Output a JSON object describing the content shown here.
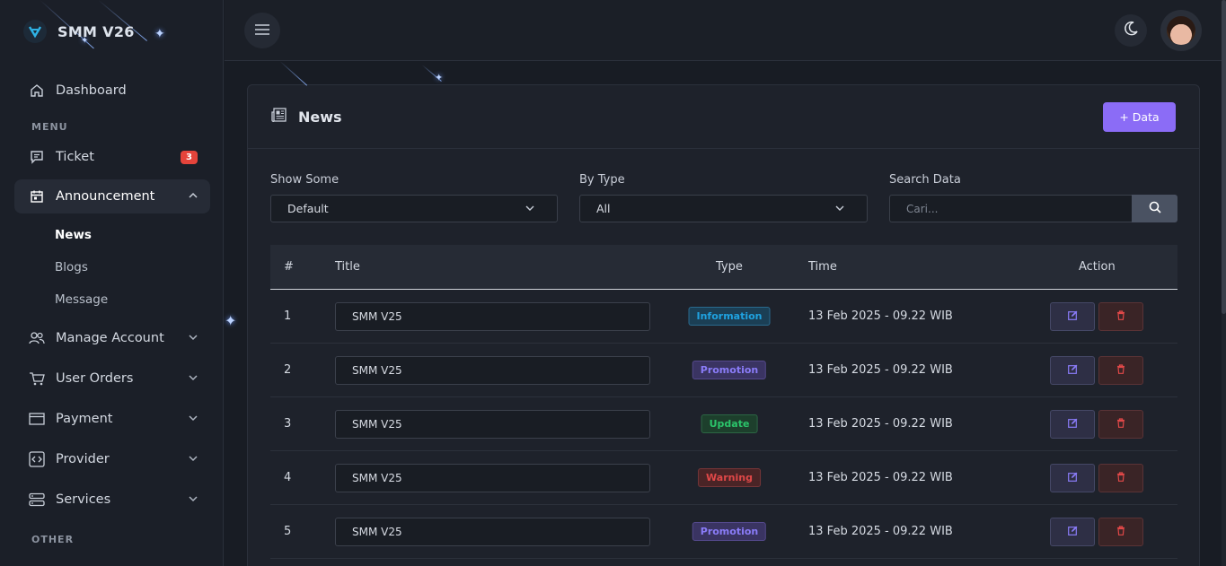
{
  "brand": {
    "name": "SMM V26"
  },
  "sidebar": {
    "dashboard": "Dashboard",
    "menu_label": "MENU",
    "ticket": {
      "label": "Ticket",
      "badge": "3"
    },
    "announcement": {
      "label": "Announcement",
      "children": [
        "News",
        "Blogs",
        "Message"
      ]
    },
    "items": [
      "Manage Account",
      "User Orders",
      "Payment",
      "Provider",
      "Services"
    ],
    "other_label": "OTHER"
  },
  "page": {
    "title": "News",
    "add_button": "+ Data"
  },
  "filters": {
    "show_label": "Show Some",
    "show_value": "Default",
    "type_label": "By Type",
    "type_value": "All",
    "search_label": "Search Data",
    "search_placeholder": "Cari..."
  },
  "table": {
    "headers": [
      "#",
      "Title",
      "Type",
      "Time",
      "Action"
    ],
    "rows": [
      {
        "no": "1",
        "title": "SMM V25",
        "type": "Information",
        "time": "13 Feb 2025 - 09.22 WIB"
      },
      {
        "no": "2",
        "title": "SMM V25",
        "type": "Promotion",
        "time": "13 Feb 2025 - 09.22 WIB"
      },
      {
        "no": "3",
        "title": "SMM V25",
        "type": "Update",
        "time": "13 Feb 2025 - 09.22 WIB"
      },
      {
        "no": "4",
        "title": "SMM V25",
        "type": "Warning",
        "time": "13 Feb 2025 - 09.22 WIB"
      },
      {
        "no": "5",
        "title": "SMM V25",
        "type": "Promotion",
        "time": "13 Feb 2025 - 09.22 WIB"
      }
    ]
  },
  "colors": {
    "accent": "#8b6cf6",
    "badge_red": "#e5443b",
    "information": "#1fa2e0",
    "promotion": "#8a7cf8",
    "update": "#2bc46a",
    "warning": "#e04848"
  },
  "icons": {
    "logo": "logo-icon",
    "dashboard": "home-icon",
    "ticket": "chat-icon",
    "announcement": "calendar-icon",
    "manage_account": "users-icon",
    "user_orders": "cart-icon",
    "payment": "card-icon",
    "provider": "code-icon",
    "services": "server-icon",
    "menu": "hamburger-icon",
    "theme": "moon-icon",
    "news": "newspaper-icon",
    "search": "search-icon",
    "edit": "edit-icon",
    "delete": "trash-icon"
  }
}
